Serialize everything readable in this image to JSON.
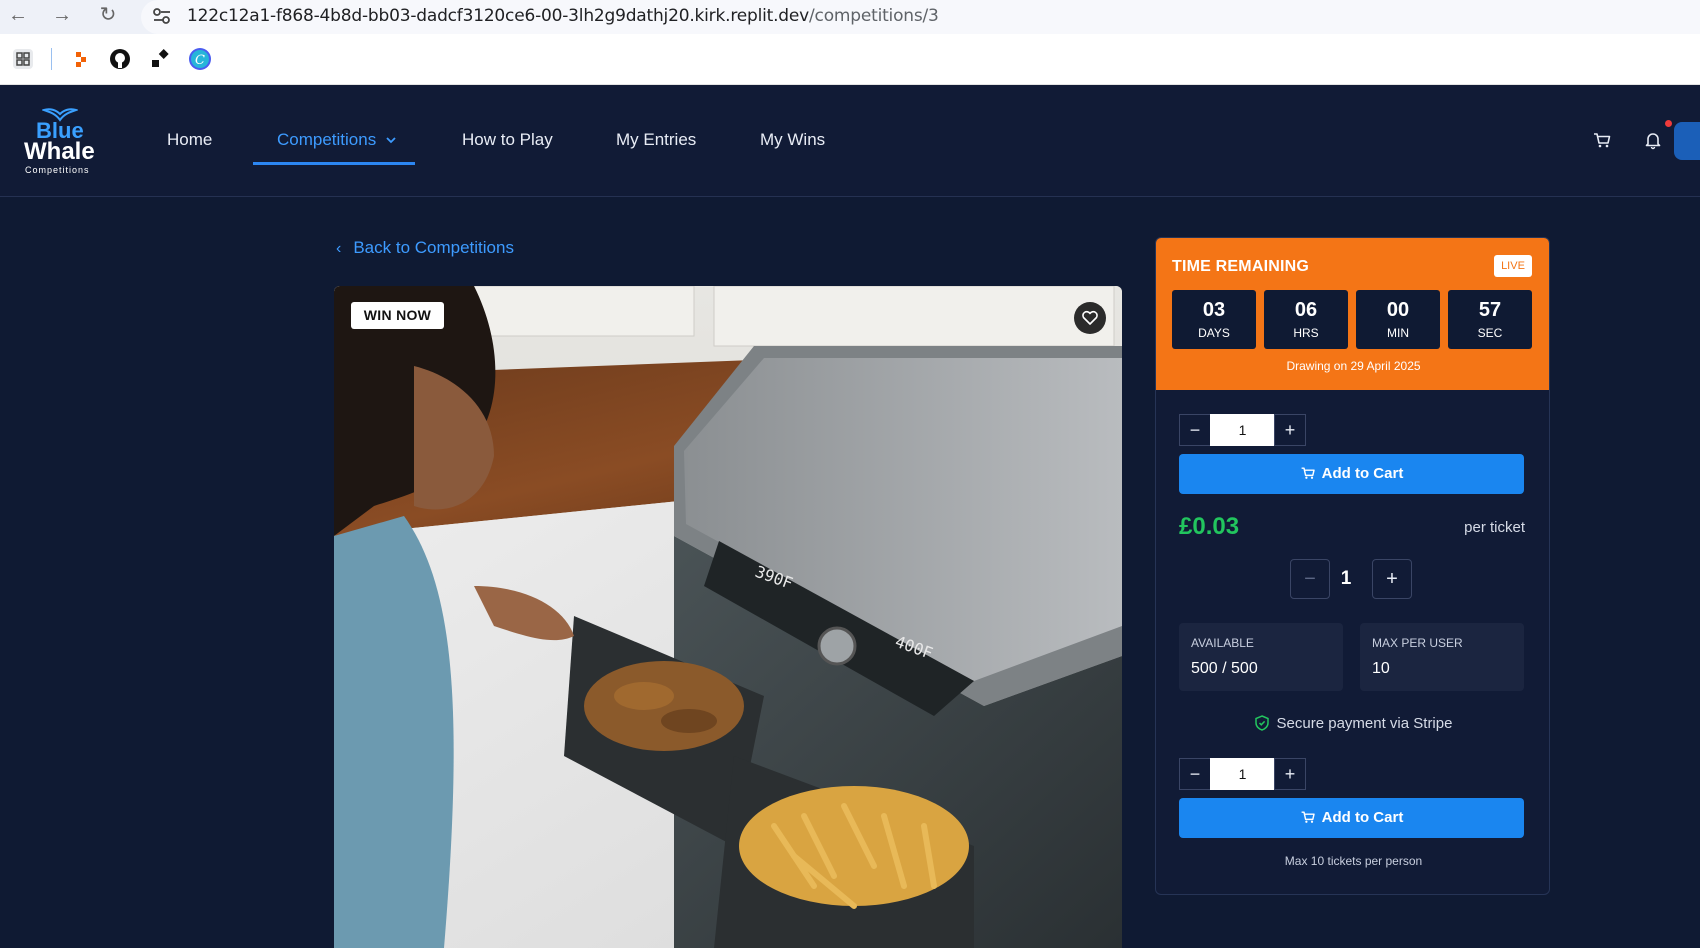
{
  "browser": {
    "url_host": "122c12a1-f868-4b8d-bb03-dadcf3120ce6-00-3lh2g9dathj20.kirk.replit.dev",
    "url_path": "/competitions/3"
  },
  "brand": {
    "line1": "Blue",
    "line2": "Whale",
    "line3": "Competitions"
  },
  "nav": {
    "home": "Home",
    "competitions": "Competitions",
    "how_to_play": "How to Play",
    "my_entries": "My Entries",
    "my_wins": "My Wins"
  },
  "back_link": "Back to Competitions",
  "hero": {
    "badge": "WIN NOW"
  },
  "timer": {
    "title": "TIME REMAINING",
    "live": "LIVE",
    "days": "03",
    "days_label": "DAYS",
    "hours": "06",
    "hours_label": "HRS",
    "minutes": "00",
    "minutes_label": "MIN",
    "seconds": "57",
    "seconds_label": "SEC",
    "drawing": "Drawing on 29 April 2025"
  },
  "purchase": {
    "stepper_top_value": "1",
    "add_to_cart": "Add to Cart",
    "price": "£0.03",
    "per_ticket": "per ticket",
    "qty_value": "1",
    "available_label": "AVAILABLE",
    "available_value": "500 / 500",
    "max_label": "MAX PER USER",
    "max_value": "10",
    "secure": "Secure payment via Stripe",
    "stepper_bottom_value": "1",
    "max_note": "Max 10 tickets per person"
  },
  "colors": {
    "accent_blue": "#1a86f0",
    "timer_orange": "#f47516",
    "price_green": "#22c55e",
    "background": "#0f1a33"
  }
}
